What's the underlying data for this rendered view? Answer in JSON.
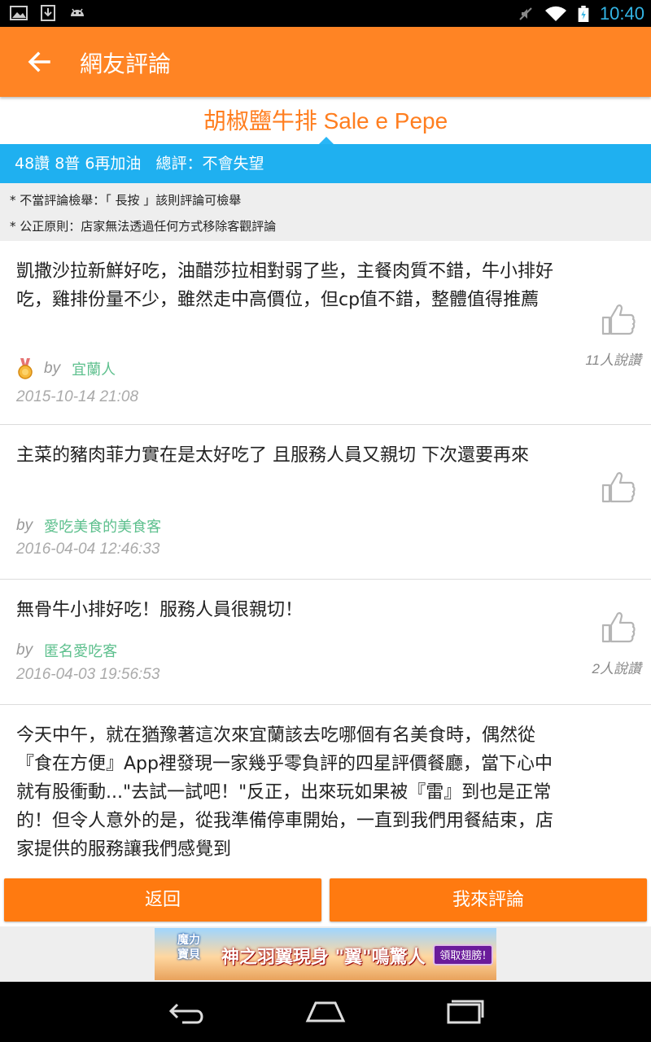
{
  "status_bar": {
    "time": "10:40"
  },
  "app_bar": {
    "title": "網友評論"
  },
  "restaurant": {
    "name": "胡椒鹽牛排 Sale e Pepe"
  },
  "summary": {
    "text": "48讚 8普 6再加油   總評：不會失望"
  },
  "notices": [
    "* 不當評論檢舉：「 長按 」該則評論可檢舉",
    "* 公正原則：店家無法透過任何方式移除客觀評論"
  ],
  "reviews": [
    {
      "text": "凱撒沙拉新鮮好吃，油醋莎拉相對弱了些，主餐肉質不錯，牛小排好吃，雞排份量不少，雖然走中高價位，但cp值不錯，整體值得推薦",
      "by": "by",
      "author": "宜蘭人",
      "date": "2015-10-14 21:08",
      "likes": "11人說讚",
      "has_medal": true
    },
    {
      "text": "主菜的豬肉菲力實在是太好吃了 且服務人員又親切 下次還要再來",
      "by": "by",
      "author": "愛吃美食的美食客",
      "date": "2016-04-04 12:46:33",
      "likes": ""
    },
    {
      "text": "無骨牛小排好吃！服務人員很親切！",
      "by": "by",
      "author": "匿名愛吃客",
      "date": "2016-04-03 19:56:53",
      "likes": "2人說讚"
    },
    {
      "text": "今天中午，就在猶豫著這次來宜蘭該去吃哪個有名美食時，偶然從『食在方便』App裡發現一家幾乎零負評的四星評價餐廳，當下心中就有股衝動...\"去試一試吧！\"反正，出來玩如果被『雷』到也是正常的！但令人意外的是，從我準備停車開始，一直到我們用餐結束，店家提供的服務讓我們感覺到"
    }
  ],
  "buttons": {
    "back": "返回",
    "write_review": "我來評論"
  },
  "ad": {
    "logo_line1": "魔力",
    "logo_line2": "寶貝",
    "headline": "神之羽翼現身 \"翼\"鳴驚人",
    "cta": "領取翅膀!"
  }
}
